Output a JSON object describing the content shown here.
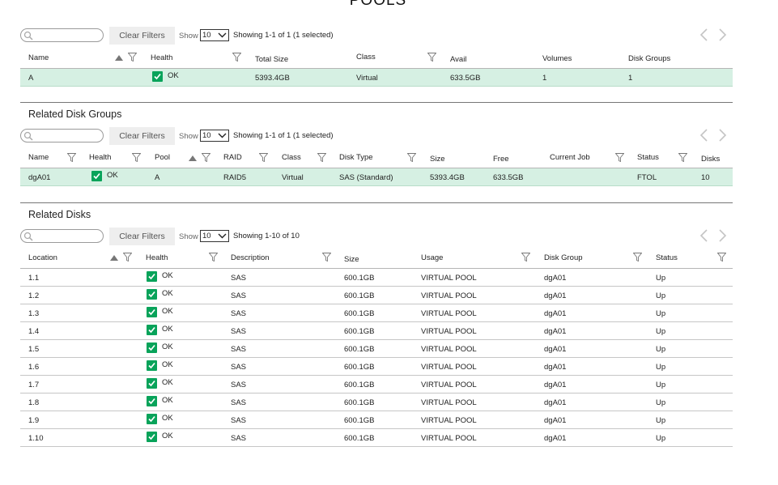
{
  "page": {
    "title": "POOLS"
  },
  "pools": {
    "search": {
      "placeholder": ""
    },
    "clear_filters": "Clear Filters",
    "show_label": "Show",
    "show_value": "10",
    "showing": "Showing 1-1 of 1 (1 selected)",
    "columns": [
      "Name",
      "Health",
      "Total Size",
      "Class",
      "Avail",
      "Volumes",
      "Disk Groups"
    ],
    "rows": [
      {
        "name": "A",
        "health": "OK",
        "total_size": "5393.4GB",
        "class": "Virtual",
        "avail": "633.5GB",
        "volumes": "1",
        "disk_groups": "1"
      }
    ]
  },
  "disk_groups": {
    "title": "Related Disk Groups",
    "search": {
      "placeholder": ""
    },
    "clear_filters": "Clear Filters",
    "show_label": "Show",
    "show_value": "10",
    "showing": "Showing 1-1 of 1 (1 selected)",
    "columns": [
      "Name",
      "Health",
      "Pool",
      "RAID",
      "Class",
      "Disk Type",
      "Size",
      "Free",
      "Current Job",
      "Status",
      "Disks"
    ],
    "rows": [
      {
        "name": "dgA01",
        "health": "OK",
        "pool": "A",
        "raid": "RAID5",
        "class": "Virtual",
        "disk_type": "SAS (Standard)",
        "size": "5393.4GB",
        "free": "633.5GB",
        "current_job": "",
        "status": "FTOL",
        "disks": "10"
      }
    ]
  },
  "disks": {
    "title": "Related Disks",
    "search": {
      "placeholder": ""
    },
    "clear_filters": "Clear Filters",
    "show_label": "Show",
    "show_value": "10",
    "showing": "Showing 1-10 of 10",
    "columns": [
      "Location",
      "Health",
      "Description",
      "Size",
      "Usage",
      "Disk Group",
      "Status"
    ],
    "rows": [
      {
        "location": "1.1",
        "health": "OK",
        "description": "SAS",
        "size": "600.1GB",
        "usage": "VIRTUAL POOL",
        "disk_group": "dgA01",
        "status": "Up"
      },
      {
        "location": "1.2",
        "health": "OK",
        "description": "SAS",
        "size": "600.1GB",
        "usage": "VIRTUAL POOL",
        "disk_group": "dgA01",
        "status": "Up"
      },
      {
        "location": "1.3",
        "health": "OK",
        "description": "SAS",
        "size": "600.1GB",
        "usage": "VIRTUAL POOL",
        "disk_group": "dgA01",
        "status": "Up"
      },
      {
        "location": "1.4",
        "health": "OK",
        "description": "SAS",
        "size": "600.1GB",
        "usage": "VIRTUAL POOL",
        "disk_group": "dgA01",
        "status": "Up"
      },
      {
        "location": "1.5",
        "health": "OK",
        "description": "SAS",
        "size": "600.1GB",
        "usage": "VIRTUAL POOL",
        "disk_group": "dgA01",
        "status": "Up"
      },
      {
        "location": "1.6",
        "health": "OK",
        "description": "SAS",
        "size": "600.1GB",
        "usage": "VIRTUAL POOL",
        "disk_group": "dgA01",
        "status": "Up"
      },
      {
        "location": "1.7",
        "health": "OK",
        "description": "SAS",
        "size": "600.1GB",
        "usage": "VIRTUAL POOL",
        "disk_group": "dgA01",
        "status": "Up"
      },
      {
        "location": "1.8",
        "health": "OK",
        "description": "SAS",
        "size": "600.1GB",
        "usage": "VIRTUAL POOL",
        "disk_group": "dgA01",
        "status": "Up"
      },
      {
        "location": "1.9",
        "health": "OK",
        "description": "SAS",
        "size": "600.1GB",
        "usage": "VIRTUAL POOL",
        "disk_group": "dgA01",
        "status": "Up"
      },
      {
        "location": "1.10",
        "health": "OK",
        "description": "SAS",
        "size": "600.1GB",
        "usage": "VIRTUAL POOL",
        "disk_group": "dgA01",
        "status": "Up"
      }
    ]
  },
  "icons": {
    "search": "search-icon",
    "filter": "filter-icon",
    "sort": "sort-ascending-icon",
    "ok": "checkmark-icon",
    "prev": "chevron-left-icon",
    "next": "chevron-right-icon",
    "dropdown": "chevron-down-icon"
  },
  "colors": {
    "selected_row": "#d6f0e3",
    "ok_green": "#08a35a",
    "button_bg": "#eeeeee"
  }
}
